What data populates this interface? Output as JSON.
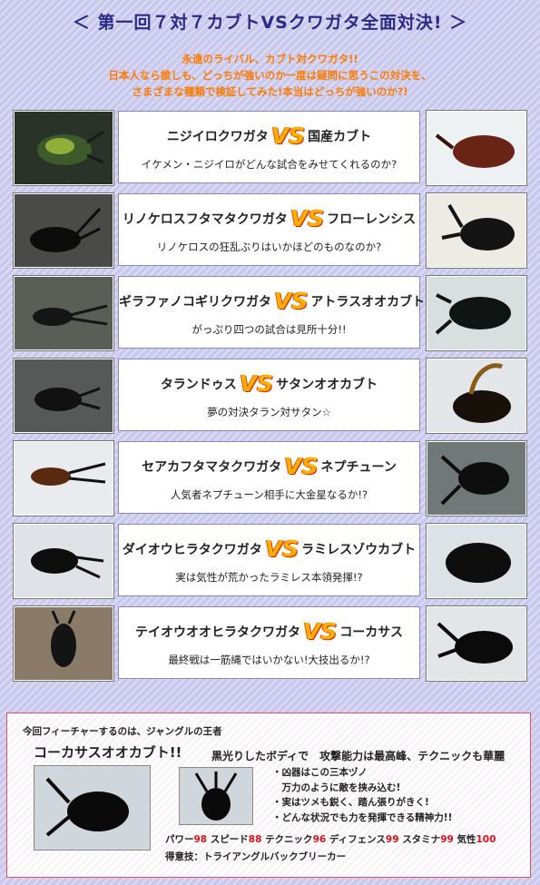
{
  "header": {
    "title": "＜ 第一回７対７カブトVSクワガタ全面対決! ＞"
  },
  "intro": {
    "lines": [
      "永遠のライバル、カブト対クワガタ!!",
      "日本人なら誰しも、どっちが強いのか一度は疑問に思うこの対決を、",
      "さまざまな種類で検証してみた!本当はどっちが強いのか?!"
    ]
  },
  "vs_label": "VS",
  "matchups": [
    {
      "left": "ニジイロクワガタ",
      "right": "国産カブト",
      "caption": "イケメン・ニジイロがどんな試合をみせてくれるのか?"
    },
    {
      "left": "リノケロスフタマタクワガタ",
      "right": "フローレンシス",
      "caption": "リノケロスの狂乱ぶりはいかほどのものなのか?"
    },
    {
      "left": "ギラファノコギリクワガタ",
      "right": "アトラスオオカブト",
      "caption": "がっぷり四つの試合は見所十分!!"
    },
    {
      "left": "タランドゥス",
      "right": "サタンオオカブト",
      "caption": "夢の対決タラン対サタン☆"
    },
    {
      "left": "セアカフタマタクワガタ",
      "right": "ネプチューン",
      "caption": "人気者ネプチューン相手に大金星なるか!?"
    },
    {
      "left": "ダイオウヒラタクワガタ",
      "right": "ラミレスゾウカブト",
      "caption": "実は気性が荒かったラミレス本領発揮!?"
    },
    {
      "left": "テイオウオオヒラタクワガタ",
      "right": "コーカサス",
      "caption": "最終戦は一筋縄ではいかない!大技出るか!?"
    }
  ],
  "feature": {
    "lead": "今回フィーチャーするのは、ジャングルの王者",
    "name": "コーカサスオオカブト!!",
    "tagline": "黒光りしたボディで　攻撃能力は最高峰、テクニックも華麗",
    "points": [
      "・凶器はこの三本ヅノ",
      "　万力のように敵を挟み込む!",
      "・実はツメも鋭く、踏ん張りがきく!",
      "・どんな状況でも力を発揮できる精神力!!"
    ],
    "stats": [
      {
        "label": "パワー",
        "value": "98"
      },
      {
        "label": "スピード",
        "value": "88"
      },
      {
        "label": "テクニック",
        "value": "96"
      },
      {
        "label": "ディフェンス",
        "value": "99"
      },
      {
        "label": "スタミナ",
        "value": "99"
      },
      {
        "label": "気性",
        "value": "100"
      }
    ],
    "special": "得意技：トライアングルバックブリーカー"
  },
  "colors": {
    "background": "#c9c9ee",
    "title": "#2a2a88",
    "intro": "#ff7a00",
    "vs": "#ffb000",
    "stat_value": "#e0101a",
    "feature_border": "#e05060"
  }
}
